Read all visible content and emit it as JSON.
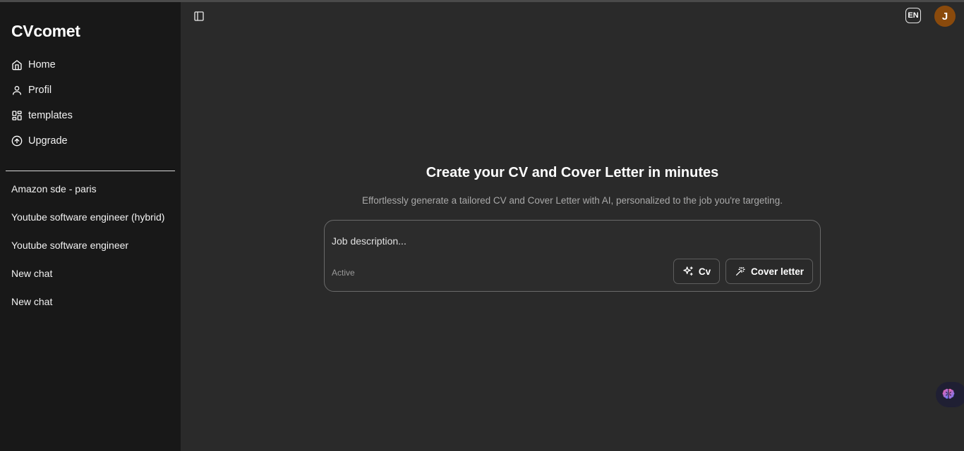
{
  "app": {
    "brand": "CVcomet"
  },
  "sidebar": {
    "nav": [
      {
        "label": "Home",
        "icon": "home-icon"
      },
      {
        "label": "Profil",
        "icon": "user-icon"
      },
      {
        "label": "templates",
        "icon": "layout-grid-icon"
      },
      {
        "label": "Upgrade",
        "icon": "arrow-up-circle-icon"
      }
    ],
    "chats": [
      "Amazon sde - paris",
      "Youtube software engineer (hybrid)",
      "Youtube software engineer",
      "New chat",
      "New chat"
    ]
  },
  "header": {
    "toggle_icon": "sidebar-toggle-icon",
    "language": "EN",
    "avatar_initial": "J"
  },
  "main": {
    "title": "Create your CV and Cover Letter in minutes",
    "subtitle": "Effortlessly generate a tailored CV and Cover Letter with AI, personalized to the job you're targeting.",
    "input": {
      "placeholder": "Job description...",
      "value": ""
    },
    "status": "Active",
    "buttons": {
      "cv": "Cv",
      "cover_letter": "Cover letter"
    }
  },
  "widget": {
    "icon": "brain-icon"
  },
  "colors": {
    "sidebar_bg": "#181818",
    "main_bg": "#2a2a2a",
    "avatar_bg": "#8a4a0c",
    "muted_text": "#a9a9a9"
  }
}
